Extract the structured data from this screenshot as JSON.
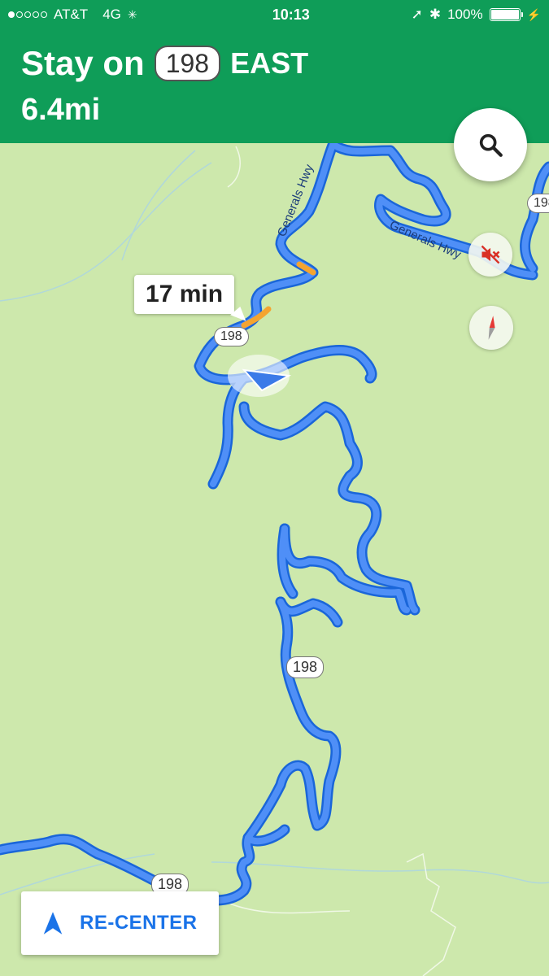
{
  "status_bar": {
    "carrier": "AT&T",
    "network": "4G",
    "time": "10:13",
    "battery_percent": "100%",
    "battery_level": 1.0,
    "signal_bars_filled": 1,
    "signal_bars_total": 5
  },
  "navigation": {
    "instruction_prefix": "Stay on",
    "route_shield": "198",
    "direction": "EAST",
    "distance": "6.4mi"
  },
  "map": {
    "eta_bubble": "17 min",
    "road_shields": [
      "198",
      "198",
      "198",
      "198"
    ],
    "road_labels": [
      "Generals Hwy",
      "Generals Hwy"
    ],
    "colors": {
      "land": "#cde8ac",
      "route": "#4285f4",
      "route_border": "#1a66d9",
      "traffic": "#f4a430",
      "header": "#0f9d58"
    }
  },
  "controls": {
    "search_icon": "search-icon",
    "mute_icon": "volume-off-icon",
    "compass_icon": "compass-icon",
    "recenter_label": "RE-CENTER",
    "recenter_icon": "navigation-arrow-icon"
  }
}
